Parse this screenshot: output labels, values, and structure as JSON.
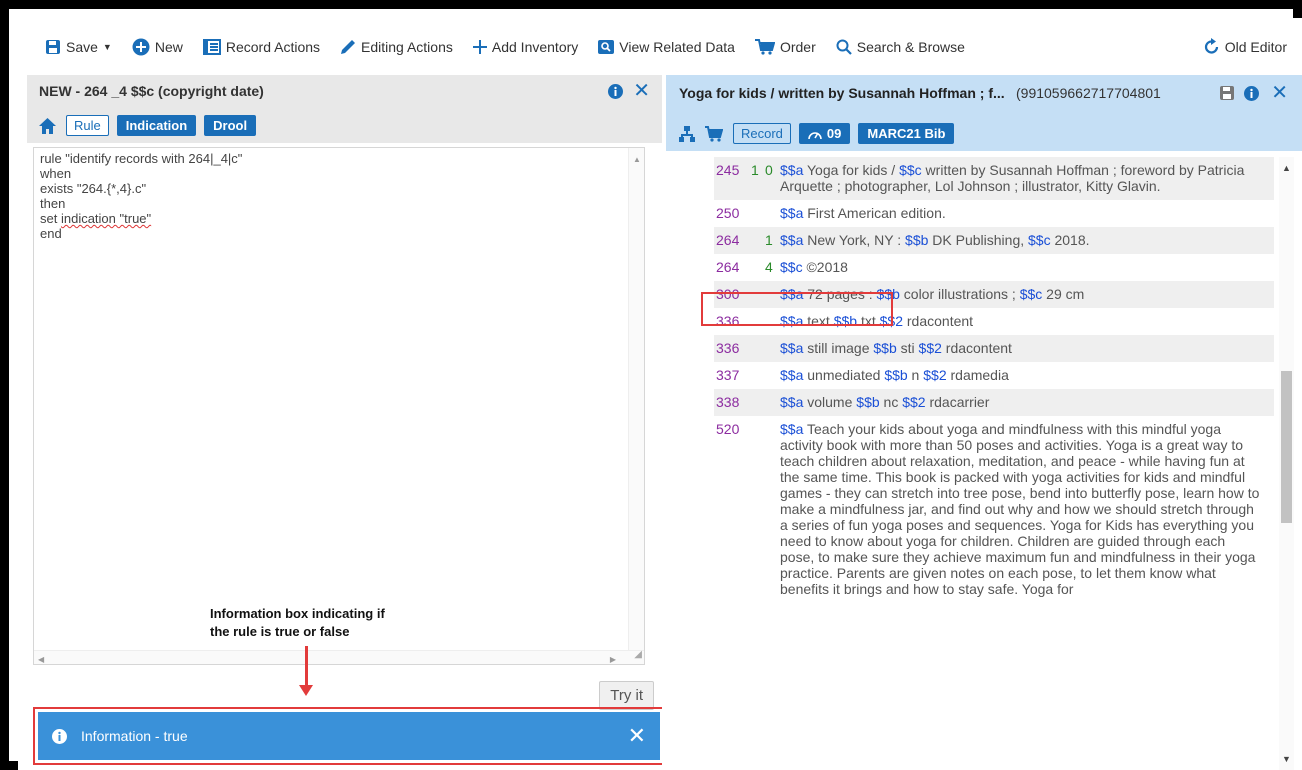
{
  "toolbar": {
    "save": "Save",
    "new": "New",
    "record_actions": "Record Actions",
    "editing_actions": "Editing Actions",
    "add_inventory": "Add Inventory",
    "view_related": "View Related Data",
    "order": "Order",
    "search_browse": "Search & Browse",
    "old_editor": "Old Editor"
  },
  "left_panel": {
    "title": "NEW - 264 _4 $$c (copyright date)",
    "buttons": {
      "rule": "Rule",
      "indication": "Indication",
      "drool": "Drool"
    },
    "editor_lines": [
      "rule \"identify records with 264|_4|c\"",
      "when",
      "exists \"264.{*,4}.c\"",
      "then"
    ],
    "editor_line_set_prefix": "set ",
    "editor_line_set_squiggle": "indication \"true\"",
    "editor_line_end": "end",
    "annotation_line1": "Information box indicating if",
    "annotation_line2": "the rule is true or false",
    "try_it": "Try it",
    "info_message": "Information - true"
  },
  "right_panel": {
    "title": "Yoga for kids / written by Susannah Hoffman ; f...",
    "mms_id": "(991059662717704801",
    "buttons": {
      "record": "Record",
      "count": "09",
      "format": "MARC21 Bib"
    },
    "fields": [
      {
        "tag": "245",
        "ind1": "1",
        "ind2": "0",
        "parts": [
          [
            "$$a",
            " Yoga for kids / "
          ],
          [
            "$$c",
            " written by Susannah Hoffman ; foreword by Patricia Arquette ; photographer, Lol Johnson ; illustrator, Kitty Glavin."
          ]
        ]
      },
      {
        "tag": "250",
        "ind1": "",
        "ind2": "",
        "parts": [
          [
            "$$a",
            " First American edition."
          ]
        ]
      },
      {
        "tag": "264",
        "ind1": "",
        "ind2": "1",
        "parts": [
          [
            "$$a",
            " New York, NY : "
          ],
          [
            "$$b",
            " DK Publishing, "
          ],
          [
            "$$c",
            " 2018."
          ]
        ]
      },
      {
        "tag": "264",
        "ind1": "",
        "ind2": "4",
        "parts": [
          [
            "$$c",
            " ©2018"
          ]
        ]
      },
      {
        "tag": "300",
        "ind1": "",
        "ind2": "",
        "parts": [
          [
            "$$a",
            " 72 pages : "
          ],
          [
            "$$b",
            " color illustrations ; "
          ],
          [
            "$$c",
            " 29 cm"
          ]
        ]
      },
      {
        "tag": "336",
        "ind1": "",
        "ind2": "",
        "parts": [
          [
            "$$a",
            " text "
          ],
          [
            "$$b",
            " txt "
          ],
          [
            "$$2",
            " rdacontent"
          ]
        ]
      },
      {
        "tag": "336",
        "ind1": "",
        "ind2": "",
        "parts": [
          [
            "$$a",
            " still image "
          ],
          [
            "$$b",
            " sti "
          ],
          [
            "$$2",
            " rdacontent"
          ]
        ]
      },
      {
        "tag": "337",
        "ind1": "",
        "ind2": "",
        "parts": [
          [
            "$$a",
            " unmediated "
          ],
          [
            "$$b",
            " n "
          ],
          [
            "$$2",
            " rdamedia"
          ]
        ]
      },
      {
        "tag": "338",
        "ind1": "",
        "ind2": "",
        "parts": [
          [
            "$$a",
            " volume "
          ],
          [
            "$$b",
            " nc "
          ],
          [
            "$$2",
            " rdacarrier"
          ]
        ]
      },
      {
        "tag": "520",
        "ind1": "",
        "ind2": "",
        "parts": [
          [
            "$$a",
            " Teach your kids about yoga and mindfulness with this mindful yoga activity book with more than 50 poses and activities. Yoga is a great way to teach children about relaxation, meditation, and peace - while having fun at the same time. This book is packed with yoga activities for kids and mindful games - they can stretch into tree pose, bend into butterfly pose, learn how to make a mindfulness jar, and find out why and how we should stretch through a series of fun yoga poses and sequences. Yoga for Kids has everything you need to know about yoga for children. Children are guided through each pose, to make sure they achieve maximum fun and mindfulness in their yoga practice. Parents are given notes on each pose, to let them know what benefits it brings and how to stay safe. Yoga for"
          ]
        ]
      }
    ]
  },
  "colors": {
    "accent_blue": "#1a6eb8",
    "info_bar": "#3a91d9",
    "highlight_red": "#e23b3b",
    "tag_purple": "#8c2ca0",
    "indicator_green": "#2a8a2a",
    "subfield_blue": "#1a4fd6",
    "right_header_bg": "#c5dff5"
  }
}
